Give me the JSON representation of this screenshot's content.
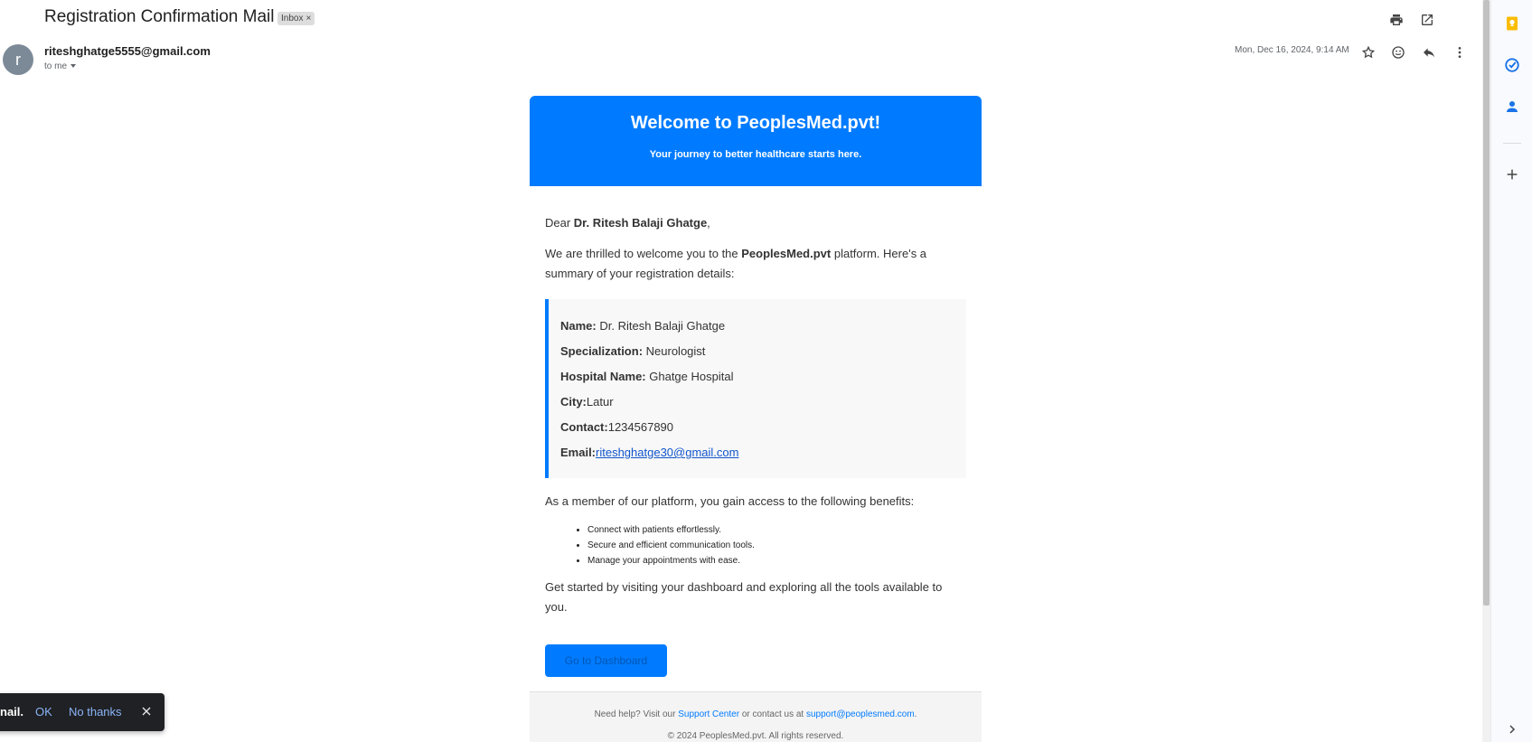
{
  "email": {
    "subject": "Registration Confirmation Mail",
    "label_chip": "Inbox",
    "label_chip_close": "×",
    "sender": "riteshghatge5555@gmail.com",
    "avatar_letter": "r",
    "recipient": "to me",
    "date": "Mon, Dec 16, 2024, 9:14 AM"
  },
  "toolbar": {
    "icons": [
      "print-icon",
      "open-in-new-window-icon",
      "star-icon",
      "emoji-reaction-icon",
      "reply-icon",
      "more-options-icon"
    ]
  },
  "card": {
    "hero_title": "Welcome to PeoplesMed.pvt!",
    "hero_subtitle": "Your journey to better healthcare starts here.",
    "greeting_prefix": "Dear ",
    "greeting_name": "Dr. Ritesh Balaji Ghatge",
    "greeting_suffix": ",",
    "intro_before": "We are thrilled to welcome you to the ",
    "intro_brand": "PeoplesMed.pvt",
    "intro_after": " platform. Here's a summary of your registration details:",
    "details": {
      "name_label": "Name:",
      "name_value": " Dr. Ritesh Balaji Ghatge",
      "specialization_label": "Specialization:",
      "specialization_value": " Neurologist",
      "hospital_label": "Hospital Name:",
      "hospital_value": " Ghatge Hospital",
      "city_label": "City:",
      "city_value": "Latur",
      "contact_label": "Contact:",
      "contact_value": "1234567890",
      "email_label": "Email:",
      "email_value": "riteshghatge30@gmail.com"
    },
    "benefits_intro": "As a member of our platform, you gain access to the following benefits:",
    "benefits": [
      "Connect with patients effortlessly.",
      "Secure and efficient communication tools.",
      "Manage your appointments with ease."
    ],
    "closing": "Get started by visiting your dashboard and exploring all the tools available to you.",
    "cta_label": "Go to Dashboard",
    "footer": {
      "help_prefix": "Need help? Visit our ",
      "support_link": "Support Center",
      "help_middle": " or contact us at ",
      "support_email": "support@peoplesmed.com",
      "help_suffix": ".",
      "copyright": "© 2024 PeoplesMed.pvt. All rights reserved."
    }
  },
  "side_panel": {
    "icons": [
      "keep-icon",
      "tasks-icon",
      "contacts-icon",
      "add-icon",
      "collapse-panel-icon"
    ]
  },
  "toast": {
    "message": "nail.",
    "ok_label": "OK",
    "no_label": "No thanks"
  },
  "colors": {
    "accent": "#007bff",
    "link": "#1155cc",
    "toast_bg": "#202124",
    "toast_link": "#8ab4f8"
  }
}
